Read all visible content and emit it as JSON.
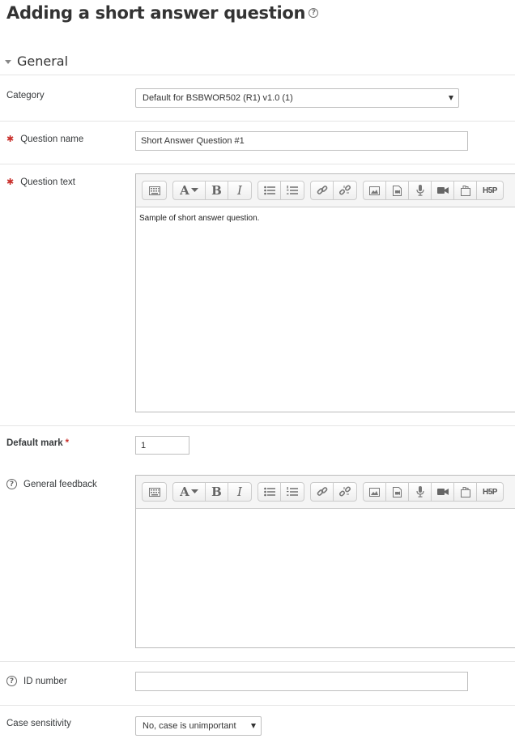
{
  "page": {
    "title": "Adding a short answer question"
  },
  "section": {
    "title": "General"
  },
  "fields": {
    "category": {
      "label": "Category",
      "value": "Default for BSBWOR502 (R1) v1.0 (1)"
    },
    "question_name": {
      "label": "Question name",
      "value": "Short Answer Question #1"
    },
    "question_text": {
      "label": "Question text",
      "content": "Sample of short answer question."
    },
    "default_mark": {
      "label": "Default mark",
      "value": "1"
    },
    "general_feedback": {
      "label": "General feedback",
      "content": ""
    },
    "id_number": {
      "label": "ID number",
      "value": ""
    },
    "case_sensitivity": {
      "label": "Case sensitivity",
      "value": "No, case is unimportant"
    }
  },
  "editor_toolbar": {
    "buttons": [
      "toggle-toolbar",
      "font-style",
      "bold",
      "italic",
      "unordered-list",
      "ordered-list",
      "link",
      "unlink",
      "image",
      "media",
      "record-audio",
      "record-video",
      "manage-files",
      "h5p"
    ],
    "bold_glyph": "B",
    "italic_glyph": "I",
    "font_glyph": "A",
    "h5p_glyph": "H5P"
  },
  "colors": {
    "required": "#c9302c",
    "text": "#373a3c",
    "border": "#bfbfbf"
  }
}
